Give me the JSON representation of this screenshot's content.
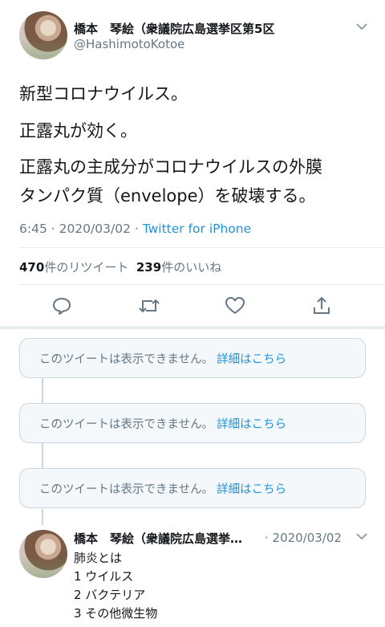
{
  "tweet": {
    "author_name": "橋本　琴絵（衆議院広島選挙区第5区",
    "author_handle": "@HashimotoKotoe",
    "lines": [
      "新型コロナウイルス。",
      "正露丸が効く。",
      "正露丸の主成分がコロナウイルスの外膜",
      "タンパク質（envelope）を破壊する。"
    ],
    "time_date": "6:45 · 2020/03/02 · ",
    "source": "Twitter for iPhone",
    "retweet_count": "470",
    "retweet_label": "件のリツイート",
    "like_count": "239",
    "like_label": "件のいいね"
  },
  "actions": {
    "reply_icon": "comment-icon",
    "retweet_icon": "retweet-icon",
    "like_icon": "heart-icon",
    "share_icon": "share-icon"
  },
  "unavailable": [
    {
      "text": "このツイートは表示できません。",
      "link": "詳細はこちら"
    },
    {
      "text": "このツイートは表示できません。",
      "link": "詳細はこちら"
    },
    {
      "text": "このツイートは表示できません。",
      "link": "詳細はこちら"
    }
  ],
  "reply": {
    "author_name": "橋本　琴絵（衆議院広島選挙…",
    "date": "· 2020/03/02",
    "lines": [
      "肺炎とは",
      "1 ウイルス",
      "2 バクテリア",
      "3 その他微生物"
    ]
  },
  "colors": {
    "link": "#1b95e0",
    "muted": "#657786",
    "border": "#ccd6dd"
  }
}
